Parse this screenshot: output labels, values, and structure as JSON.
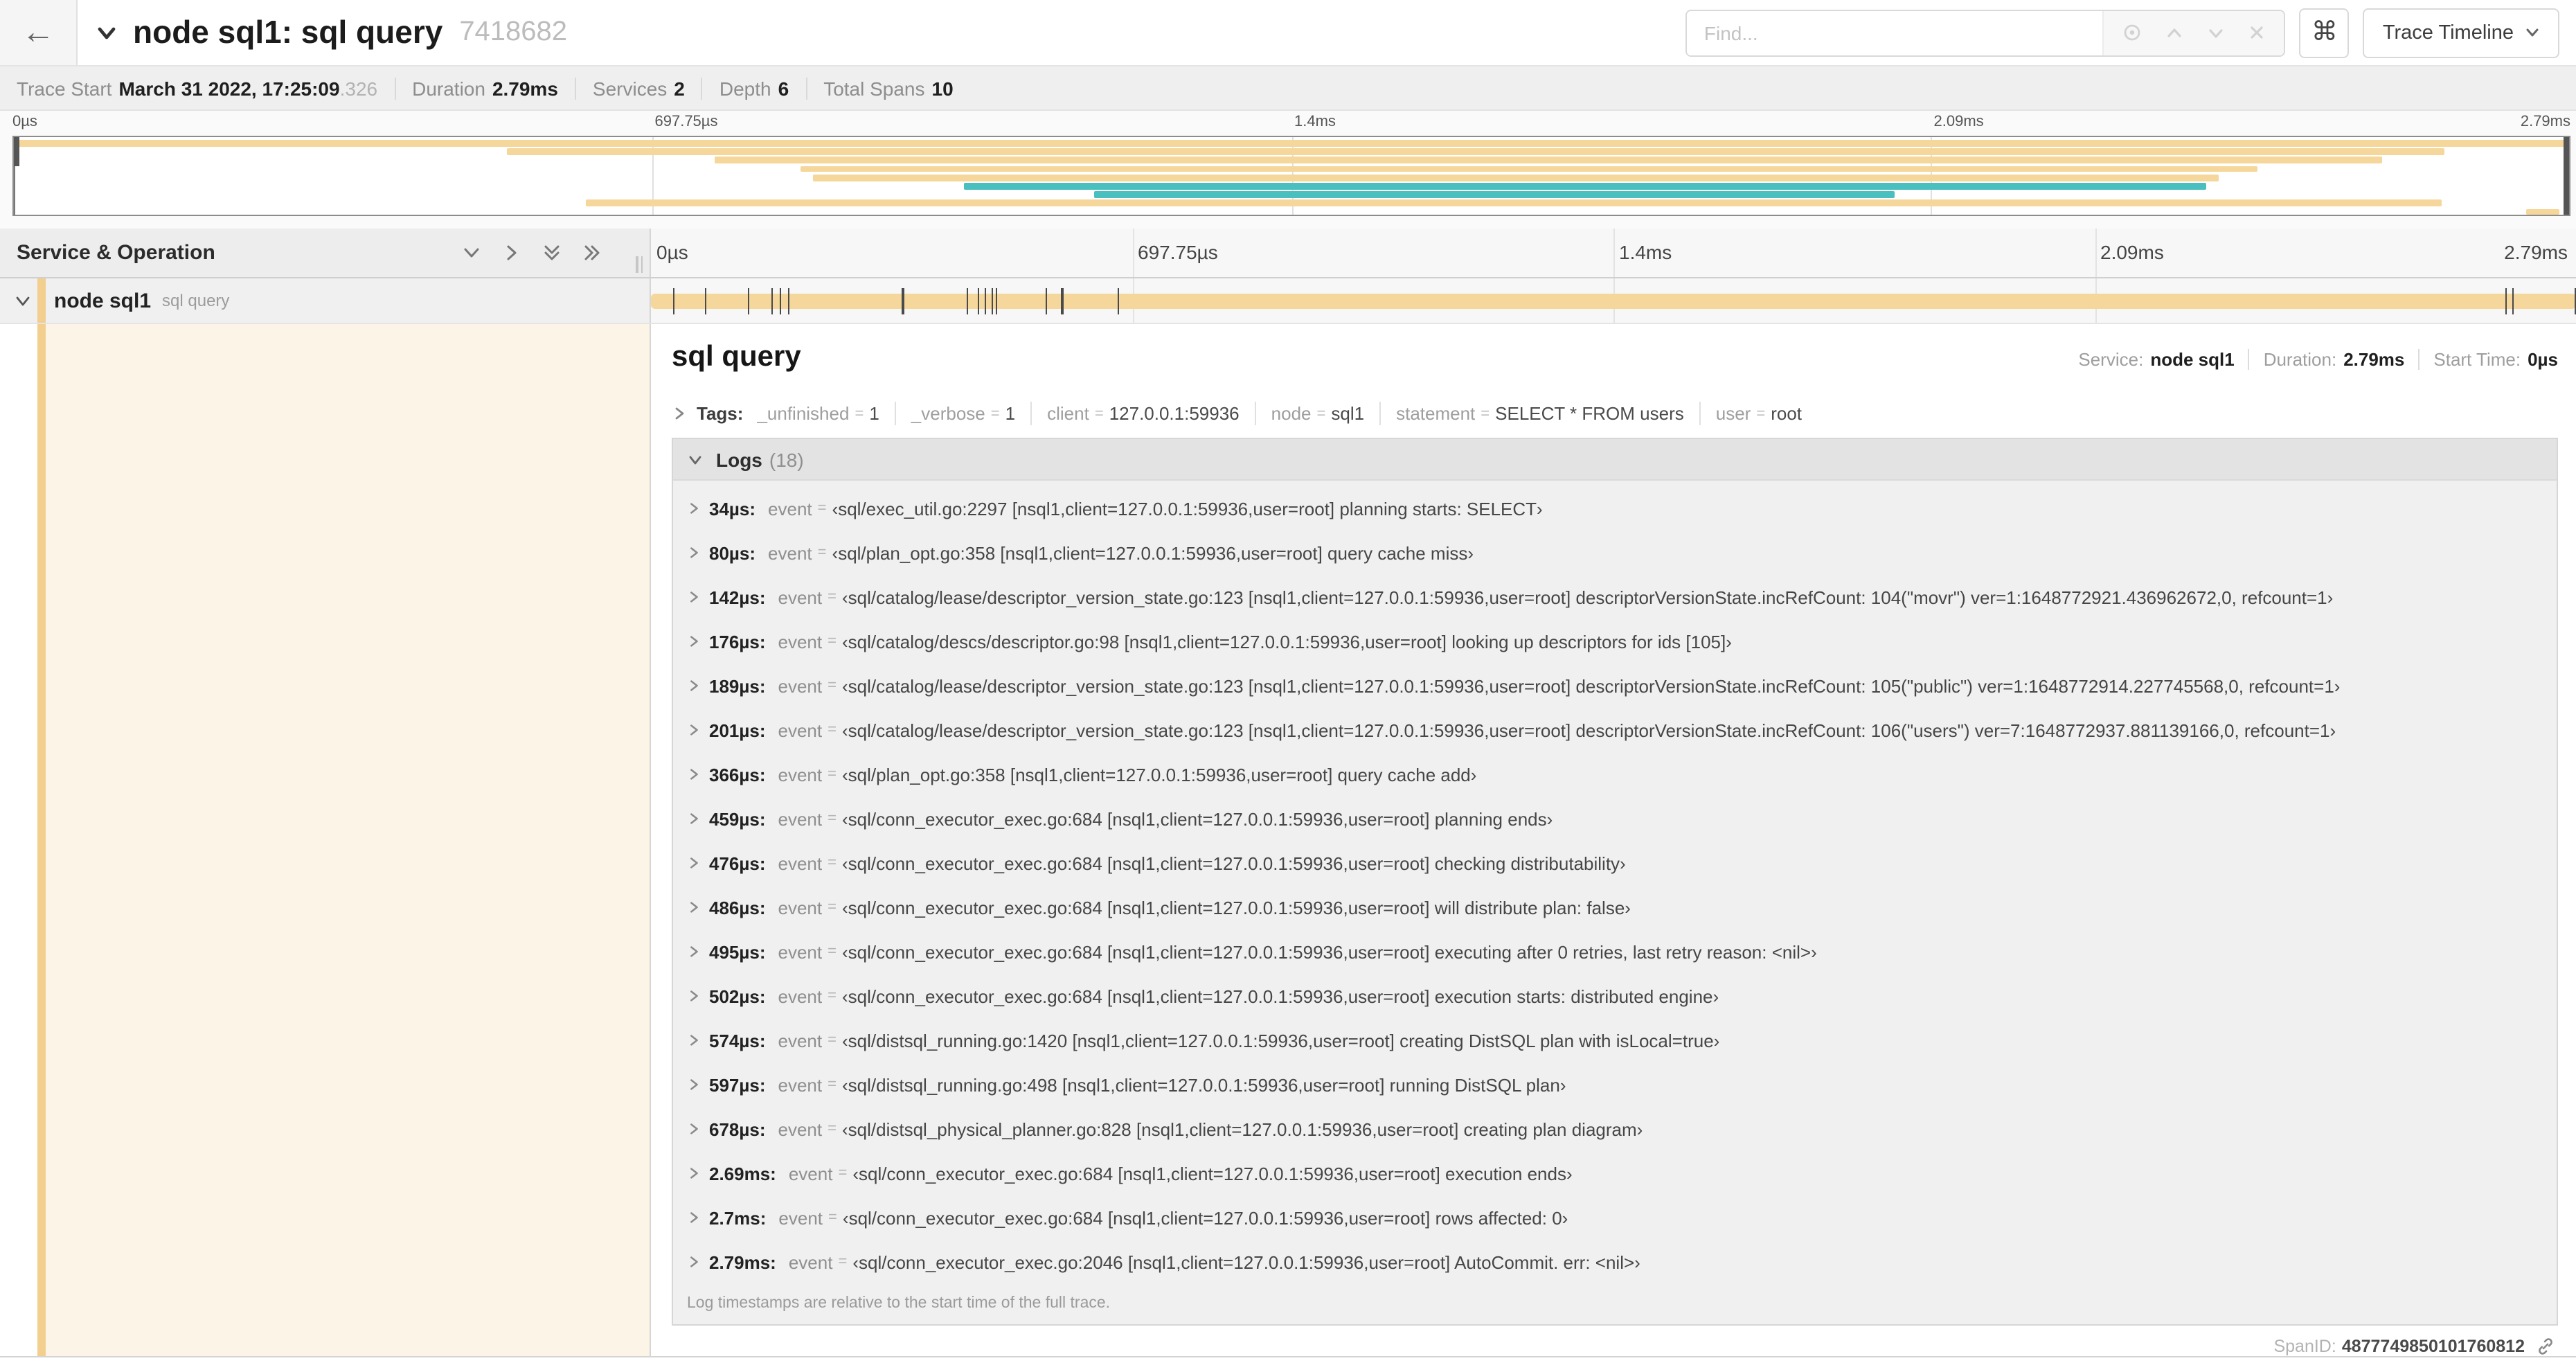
{
  "colors": {
    "tan": "#F5D79B",
    "teal": "#4ABFBF",
    "strip": "#F2CF8F",
    "cream": "#FCF5E7"
  },
  "header": {
    "back_icon": "←",
    "title": "node sql1: sql query",
    "trace_id": "7418682",
    "find_placeholder": "Find...",
    "kbd_icon": "⌘",
    "view_button_label": "Trace Timeline"
  },
  "stats": {
    "items": [
      {
        "label": "Trace Start",
        "value": "March 31 2022, 17:25:09",
        "suffix": ".326"
      },
      {
        "label": "Duration",
        "value": "2.79ms"
      },
      {
        "label": "Services",
        "value": "2"
      },
      {
        "label": "Depth",
        "value": "6"
      },
      {
        "label": "Total Spans",
        "value": "10"
      }
    ]
  },
  "timeline": {
    "axis_ticks": [
      {
        "label": "0µs",
        "pct": 0
      },
      {
        "label": "697.75µs",
        "pct": 25
      },
      {
        "label": "1.4ms",
        "pct": 50
      },
      {
        "label": "2.09ms",
        "pct": 75
      },
      {
        "label": "2.79ms",
        "pct": 100
      }
    ],
    "grid_pcts": [
      25,
      50,
      75
    ]
  },
  "minimap": {
    "spans": [
      {
        "start_pct": 0,
        "end_pct": 100,
        "color": "tan"
      },
      {
        "start_pct": 19.3,
        "end_pct": 95.1,
        "color": "tan"
      },
      {
        "start_pct": 27.4,
        "end_pct": 92.7,
        "color": "tan"
      },
      {
        "start_pct": 30.8,
        "end_pct": 87.8,
        "color": "tan"
      },
      {
        "start_pct": 31.3,
        "end_pct": 86.3,
        "color": "tan"
      },
      {
        "start_pct": 37.2,
        "end_pct": 85.8,
        "color": "teal"
      },
      {
        "start_pct": 42.3,
        "end_pct": 73.6,
        "color": "teal"
      },
      {
        "start_pct": 22.4,
        "end_pct": 95.0,
        "color": "tan"
      },
      {
        "start_pct": 98.3,
        "end_pct": 99.6,
        "color": "tan"
      }
    ]
  },
  "grid": {
    "left_header": "Service & Operation"
  },
  "span_row": {
    "service": "node sql1",
    "operation": "sql query",
    "bar": {
      "start_pct": 0,
      "end_pct": 100,
      "color": "tan"
    }
  },
  "detail": {
    "title": "sql query",
    "meta": [
      {
        "label": "Service:",
        "value": "node sql1"
      },
      {
        "label": "Duration:",
        "value": "2.79ms"
      },
      {
        "label": "Start Time:",
        "value": "0µs"
      }
    ],
    "tags_label": "Tags:",
    "tags": [
      {
        "key": "_unfinished",
        "value": "1"
      },
      {
        "key": "_verbose",
        "value": "1"
      },
      {
        "key": "client",
        "value": "127.0.0.1:59936"
      },
      {
        "key": "node",
        "value": "sql1"
      },
      {
        "key": "statement",
        "value": "SELECT * FROM users"
      },
      {
        "key": "user",
        "value": "root"
      }
    ],
    "logs_label": "Logs",
    "logs_count": "(18)",
    "event_key": "event",
    "logs": [
      {
        "time": "34µs",
        "pct": 1.22,
        "text": "‹sql/exec_util.go:2297 [nsql1,client=127.0.0.1:59936,user=root] planning starts: SELECT›"
      },
      {
        "time": "80µs",
        "pct": 2.87,
        "text": "‹sql/plan_opt.go:358 [nsql1,client=127.0.0.1:59936,user=root] query cache miss›"
      },
      {
        "time": "142µs",
        "pct": 5.09,
        "text": "‹sql/catalog/lease/descriptor_version_state.go:123 [nsql1,client=127.0.0.1:59936,user=root] descriptorVersionState.incRefCount: 104(\"movr\") ver=1:1648772921.436962672,0, refcount=1›"
      },
      {
        "time": "176µs",
        "pct": 6.31,
        "text": "‹sql/catalog/descs/descriptor.go:98 [nsql1,client=127.0.0.1:59936,user=root] looking up descriptors for ids [105]›"
      },
      {
        "time": "189µs",
        "pct": 6.77,
        "text": "‹sql/catalog/lease/descriptor_version_state.go:123 [nsql1,client=127.0.0.1:59936,user=root] descriptorVersionState.incRefCount: 105(\"public\") ver=1:1648772914.227745568,0, refcount=1›"
      },
      {
        "time": "201µs",
        "pct": 7.2,
        "text": "‹sql/catalog/lease/descriptor_version_state.go:123 [nsql1,client=127.0.0.1:59936,user=root] descriptorVersionState.incRefCount: 106(\"users\") ver=7:1648772937.881139166,0, refcount=1›"
      },
      {
        "time": "366µs",
        "pct": 13.12,
        "text": "‹sql/plan_opt.go:358 [nsql1,client=127.0.0.1:59936,user=root] query cache add›"
      },
      {
        "time": "459µs",
        "pct": 16.45,
        "text": "‹sql/conn_executor_exec.go:684 [nsql1,client=127.0.0.1:59936,user=root] planning ends›"
      },
      {
        "time": "476µs",
        "pct": 17.06,
        "text": "‹sql/conn_executor_exec.go:684 [nsql1,client=127.0.0.1:59936,user=root] checking distributability›"
      },
      {
        "time": "486µs",
        "pct": 17.42,
        "text": "‹sql/conn_executor_exec.go:684 [nsql1,client=127.0.0.1:59936,user=root] will distribute plan: false›"
      },
      {
        "time": "495µs",
        "pct": 17.74,
        "text": "‹sql/conn_executor_exec.go:684 [nsql1,client=127.0.0.1:59936,user=root] executing after 0 retries, last retry reason: <nil>›"
      },
      {
        "time": "502µs",
        "pct": 17.99,
        "text": "‹sql/conn_executor_exec.go:684 [nsql1,client=127.0.0.1:59936,user=root] execution starts: distributed engine›"
      },
      {
        "time": "574µs",
        "pct": 20.57,
        "text": "‹sql/distsql_running.go:1420 [nsql1,client=127.0.0.1:59936,user=root] creating DistSQL plan with isLocal=true›"
      },
      {
        "time": "597µs",
        "pct": 21.4,
        "text": "‹sql/distsql_running.go:498 [nsql1,client=127.0.0.1:59936,user=root] running DistSQL plan›"
      },
      {
        "time": "678µs",
        "pct": 24.3,
        "text": "‹sql/distsql_physical_planner.go:828 [nsql1,client=127.0.0.1:59936,user=root] creating plan diagram›"
      },
      {
        "time": "2.69ms",
        "pct": 96.42,
        "text": "‹sql/conn_executor_exec.go:684 [nsql1,client=127.0.0.1:59936,user=root] execution ends›"
      },
      {
        "time": "2.7ms",
        "pct": 96.77,
        "text": "‹sql/conn_executor_exec.go:684 [nsql1,client=127.0.0.1:59936,user=root] rows affected: 0›"
      },
      {
        "time": "2.79ms",
        "pct": 100,
        "text": "‹sql/conn_executor_exec.go:2046 [nsql1,client=127.0.0.1:59936,user=root] AutoCommit. err: <nil>›"
      }
    ],
    "logs_note": "Log timestamps are relative to the start time of the full trace.",
    "spanid_label": "SpanID:",
    "spanid": "4877749850101760812"
  }
}
